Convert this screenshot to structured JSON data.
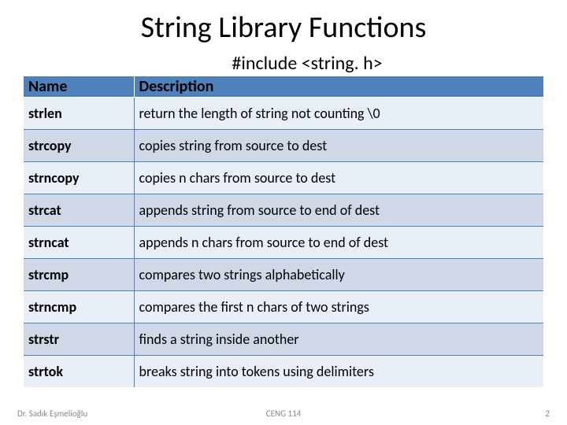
{
  "title": "String Library Functions",
  "include_line": "#include <string. h>",
  "table": {
    "headers": {
      "name": "Name",
      "desc": "Description"
    },
    "rows": [
      {
        "name": "strlen",
        "desc": "return the length of string not counting \\0"
      },
      {
        "name": "strcopy",
        "desc": "copies string from source to dest"
      },
      {
        "name": "strncopy",
        "desc": "copies n chars from source to dest"
      },
      {
        "name": "strcat",
        "desc": "appends string from source to end of dest"
      },
      {
        "name": "strncat",
        "desc": "appends n chars from source to end of dest"
      },
      {
        "name": "strcmp",
        "desc": "compares two strings alphabetically"
      },
      {
        "name": "strncmp",
        "desc": "compares the first n chars of two strings"
      },
      {
        "name": "strstr",
        "desc": "finds a string inside another"
      },
      {
        "name": "strtok",
        "desc": "breaks string into tokens using delimiters"
      }
    ]
  },
  "footer": {
    "author": "Dr. Sadık Eşmelioğlu",
    "course": "CENG 114",
    "page": "2"
  }
}
